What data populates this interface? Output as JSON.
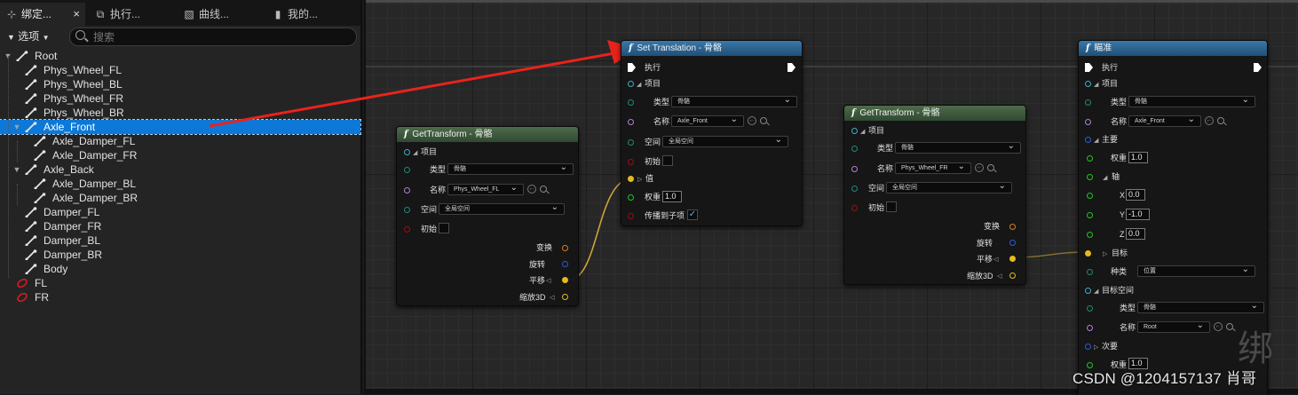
{
  "tabs": [
    {
      "label": "绑定...",
      "icon": "hierarchy-icon",
      "close": "×"
    },
    {
      "label": "执行...",
      "icon": "execution-stack-icon"
    },
    {
      "label": "曲线...",
      "icon": "curve-icon"
    },
    {
      "label": "我的...",
      "icon": "book-icon"
    }
  ],
  "toolbar": {
    "options_label": "选项",
    "search_placeholder": "搜索"
  },
  "tree": {
    "items": [
      {
        "label": "Root",
        "type": "bone"
      },
      {
        "label": "Phys_Wheel_FL",
        "type": "bone"
      },
      {
        "label": "Phys_Wheel_BL",
        "type": "bone"
      },
      {
        "label": "Phys_Wheel_FR",
        "type": "bone"
      },
      {
        "label": "Phys_Wheel_BR",
        "type": "bone"
      },
      {
        "label": "Axle_Front",
        "type": "bone",
        "selected": true
      },
      {
        "label": "Axle_Damper_FL",
        "type": "bone"
      },
      {
        "label": "Axle_Damper_FR",
        "type": "bone"
      },
      {
        "label": "Axle_Back",
        "type": "bone"
      },
      {
        "label": "Axle_Damper_BL",
        "type": "bone"
      },
      {
        "label": "Axle_Damper_BR",
        "type": "bone"
      },
      {
        "label": "Damper_FL",
        "type": "bone"
      },
      {
        "label": "Damper_FR",
        "type": "bone"
      },
      {
        "label": "Damper_BL",
        "type": "bone"
      },
      {
        "label": "Damper_BR",
        "type": "bone"
      },
      {
        "label": "Body",
        "type": "bone"
      },
      {
        "label": "FL",
        "type": "control"
      },
      {
        "label": "FR",
        "type": "control"
      }
    ]
  },
  "nodes": {
    "get1": {
      "title": "GetTransform - 骨骼",
      "item": "项目",
      "type_label": "类型",
      "type_value": "骨骼",
      "name_label": "名称",
      "name_value": "Phys_Wheel_FL",
      "space_label": "空间",
      "space_value": "全局空间",
      "initial_label": "初始",
      "out_transform": "变换",
      "out_rotation": "旋转",
      "out_translation": "平移",
      "out_scale": "缩放3D"
    },
    "set": {
      "title": "Set Translation - 骨骼",
      "exec_label": "执行",
      "item": "项目",
      "type_label": "类型",
      "type_value": "骨骼",
      "name_label": "名称",
      "name_value": "Axle_Front",
      "space_label": "空间",
      "space_value": "全局空间",
      "initial_label": "初始",
      "value_label": "值",
      "weight_label": "权重",
      "weight_value": "1.0",
      "propagate_label": "传播到子项",
      "propagate_checked": "✓"
    },
    "get2": {
      "title": "GetTransform - 骨骼",
      "item": "项目",
      "type_label": "类型",
      "type_value": "骨骼",
      "name_label": "名称",
      "name_value": "Phys_Wheel_FR",
      "space_label": "空间",
      "space_value": "全局空间",
      "initial_label": "初始",
      "out_transform": "变换",
      "out_rotation": "旋转",
      "out_translation": "平移",
      "out_scale": "缩放3D"
    },
    "aim": {
      "title": "瞄准",
      "exec_label": "执行",
      "item": "项目",
      "type_label": "类型",
      "type_value": "骨骼",
      "name_label": "名称",
      "name_value": "Axle_Front",
      "primary_label": "主要",
      "weight_label": "权重",
      "weight_value": "1.0",
      "axis_label": "轴",
      "x_label": "X",
      "x_value": "0.0",
      "y_label": "Y",
      "y_value": "-1.0",
      "z_label": "Z",
      "z_value": "0.0",
      "target_label": "目标",
      "kind_label": "种类",
      "kind_value": "位置",
      "target_space_label": "目标空间",
      "ts_type_label": "类型",
      "ts_type_value": "骨骼",
      "ts_name_label": "名称",
      "ts_name_value": "Root",
      "secondary_label": "次要",
      "weight2_label": "权重",
      "weight2_value": "1.0"
    }
  },
  "watermark": {
    "credit": "CSDN @1204157137 肖哥",
    "char": "绑"
  },
  "colors": {
    "selection": "#0d78d8",
    "annotation_arrow": "#e8231c",
    "wire_vector": "#c9a53a"
  }
}
